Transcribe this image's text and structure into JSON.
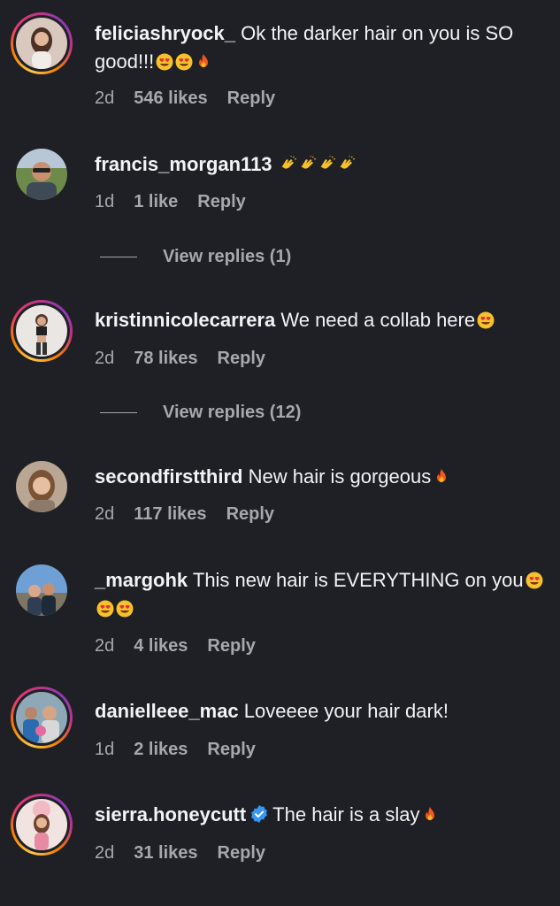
{
  "comments": [
    {
      "username": "feliciashryock_",
      "text": "Ok the darker hair on you is SO good!!!",
      "emojis": [
        "heart-eyes",
        "heart-eyes",
        "fire"
      ],
      "time": "2d",
      "likes": "546 likes",
      "reply": "Reply",
      "has_story": true
    },
    {
      "username": "francis_morgan113",
      "text": "",
      "emojis": [
        "clapping-hands",
        "clapping-hands",
        "clapping-hands",
        "clapping-hands"
      ],
      "time": "1d",
      "likes": "1 like",
      "reply": "Reply",
      "view_replies": "View replies (1)",
      "has_story": false
    },
    {
      "username": "kristinnicolecarrera",
      "text": "We need a collab here",
      "emojis": [
        "heart-eyes"
      ],
      "time": "2d",
      "likes": "78 likes",
      "reply": "Reply",
      "view_replies": "View replies (12)",
      "has_story": true
    },
    {
      "username": "secondfirstthird",
      "text": "New hair is gorgeous",
      "emojis": [
        "fire"
      ],
      "time": "2d",
      "likes": "117 likes",
      "reply": "Reply",
      "has_story": false
    },
    {
      "username": "_margohk",
      "text": "This new hair is EVERYTHING on you",
      "emojis": [
        "heart-eyes",
        "heart-eyes",
        "heart-eyes"
      ],
      "time": "2d",
      "likes": "4 likes",
      "reply": "Reply",
      "has_story": false
    },
    {
      "username": "danielleee_mac",
      "text": "Loveeee your hair dark!",
      "emojis": [],
      "time": "1d",
      "likes": "2 likes",
      "reply": "Reply",
      "has_story": true
    },
    {
      "username": "sierra.honeycutt",
      "verified": true,
      "text": "The hair is a slay",
      "emojis": [
        "fire"
      ],
      "time": "2d",
      "likes": "31 likes",
      "reply": "Reply",
      "has_story": true
    }
  ],
  "colors": {
    "background": "#1f2026",
    "text": "#f2f3f5",
    "muted": "#a6a8ae",
    "verified": "#3897f0"
  }
}
